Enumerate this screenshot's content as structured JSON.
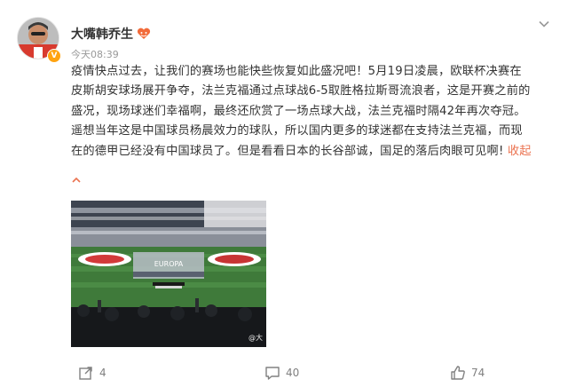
{
  "post": {
    "author": "大嘴韩乔生",
    "verified_mark": "V",
    "time": "今天08:39",
    "lines": [
      "疫情快点过去，让我们的赛场也能快些恢复如此盛况吧！5月19日凌晨，欧联杯决赛在",
      "皮斯胡安球场展开争夺，法兰克福通过点球战6-5取胜格拉斯哥流浪者，这是开赛之前的",
      "盛况，现场球迷们幸福啊，最终还欣赏了一场点球大战，法兰克福时隔42年再次夺冠。",
      "遥想当年这是中国球员杨晨效力的球队，所以国内更多的球迷都在支持法兰克福，而现",
      "在的德甲已经没有中国球员了。但是看看日本的长谷部诚，国足的落后肉眼可见啊! "
    ],
    "collapse_label": "收起",
    "image_watermark": "@大",
    "image_banner_text": "EUROPA",
    "actions": {
      "share_count": "4",
      "comment_count": "40",
      "like_count": "74"
    }
  },
  "icons": {
    "more": "chevron-down-icon",
    "collapse": "caret-up-icon",
    "share": "share-icon",
    "comment": "comment-icon",
    "like": "thumbs-up-icon",
    "fan_badge": "fan-badge-icon"
  },
  "colors": {
    "accent_link": "#eb7350",
    "muted": "#808080",
    "verified": "#ffa310"
  }
}
